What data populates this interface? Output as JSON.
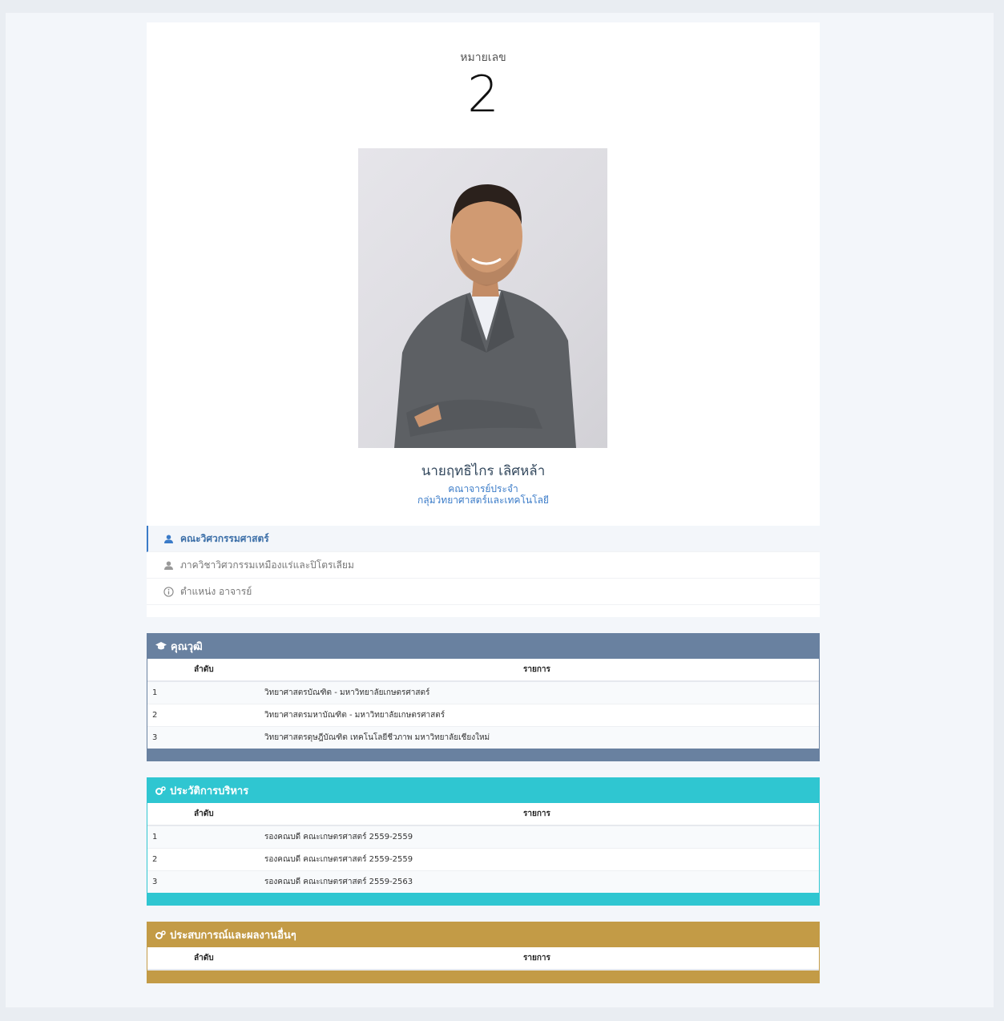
{
  "header": {
    "number_label": "หมายเลข",
    "number_value": "2"
  },
  "profile": {
    "name": "นายฤทธิไกร เลิศหล้า",
    "position_line1": "คณาจารย์ประจำ",
    "position_line2": "กลุ่มวิทยาศาสตร์และเทคโนโลยี",
    "info": [
      {
        "label": "คณะวิศวกรรมศาสตร์",
        "icon": "user-icon",
        "active": true
      },
      {
        "label": "ภาควิชาวิศวกรรมเหมืองแร่และปิโตรเลียม",
        "icon": "user-icon",
        "active": false
      },
      {
        "label": "ตำแหน่ง อาจารย์",
        "icon": "info-icon",
        "active": false
      }
    ]
  },
  "qualifications": {
    "title": "คุณวุฒิ",
    "icon": "graduation-cap-icon",
    "color": "#6981a0",
    "columns": [
      "ลำดับ",
      "รายการ"
    ],
    "rows": [
      {
        "index": "1",
        "item": "วิทยาศาสตรบัณฑิต - มหาวิทยาลัยเกษตรศาสตร์"
      },
      {
        "index": "2",
        "item": "วิทยาศาสตรมหาบัณฑิต - มหาวิทยาลัยเกษตรศาสตร์"
      },
      {
        "index": "3",
        "item": "วิทยาศาสตรดุษฎีบัณฑิต เทคโนโลยีชีวภาพ มหาวิทยาลัยเชียงใหม่"
      }
    ]
  },
  "admin_history": {
    "title": "ประวัติการบริหาร",
    "icon": "cogs-icon",
    "color": "#2fc6d1",
    "columns": [
      "ลำดับ",
      "รายการ"
    ],
    "rows": [
      {
        "index": "1",
        "item": "รองคณบดี คณะเกษตรศาสตร์ 2559-2559"
      },
      {
        "index": "2",
        "item": "รองคณบดี คณะเกษตรศาสตร์ 2559-2559"
      },
      {
        "index": "3",
        "item": "รองคณบดี คณะเกษตรศาสตร์ 2559-2563"
      }
    ]
  },
  "experience": {
    "title": "ประสบการณ์และผลงานอื่นๆ",
    "icon": "cogs-icon",
    "color": "#c39b46",
    "columns": [
      "ลำดับ",
      "รายการ"
    ],
    "rows": []
  }
}
